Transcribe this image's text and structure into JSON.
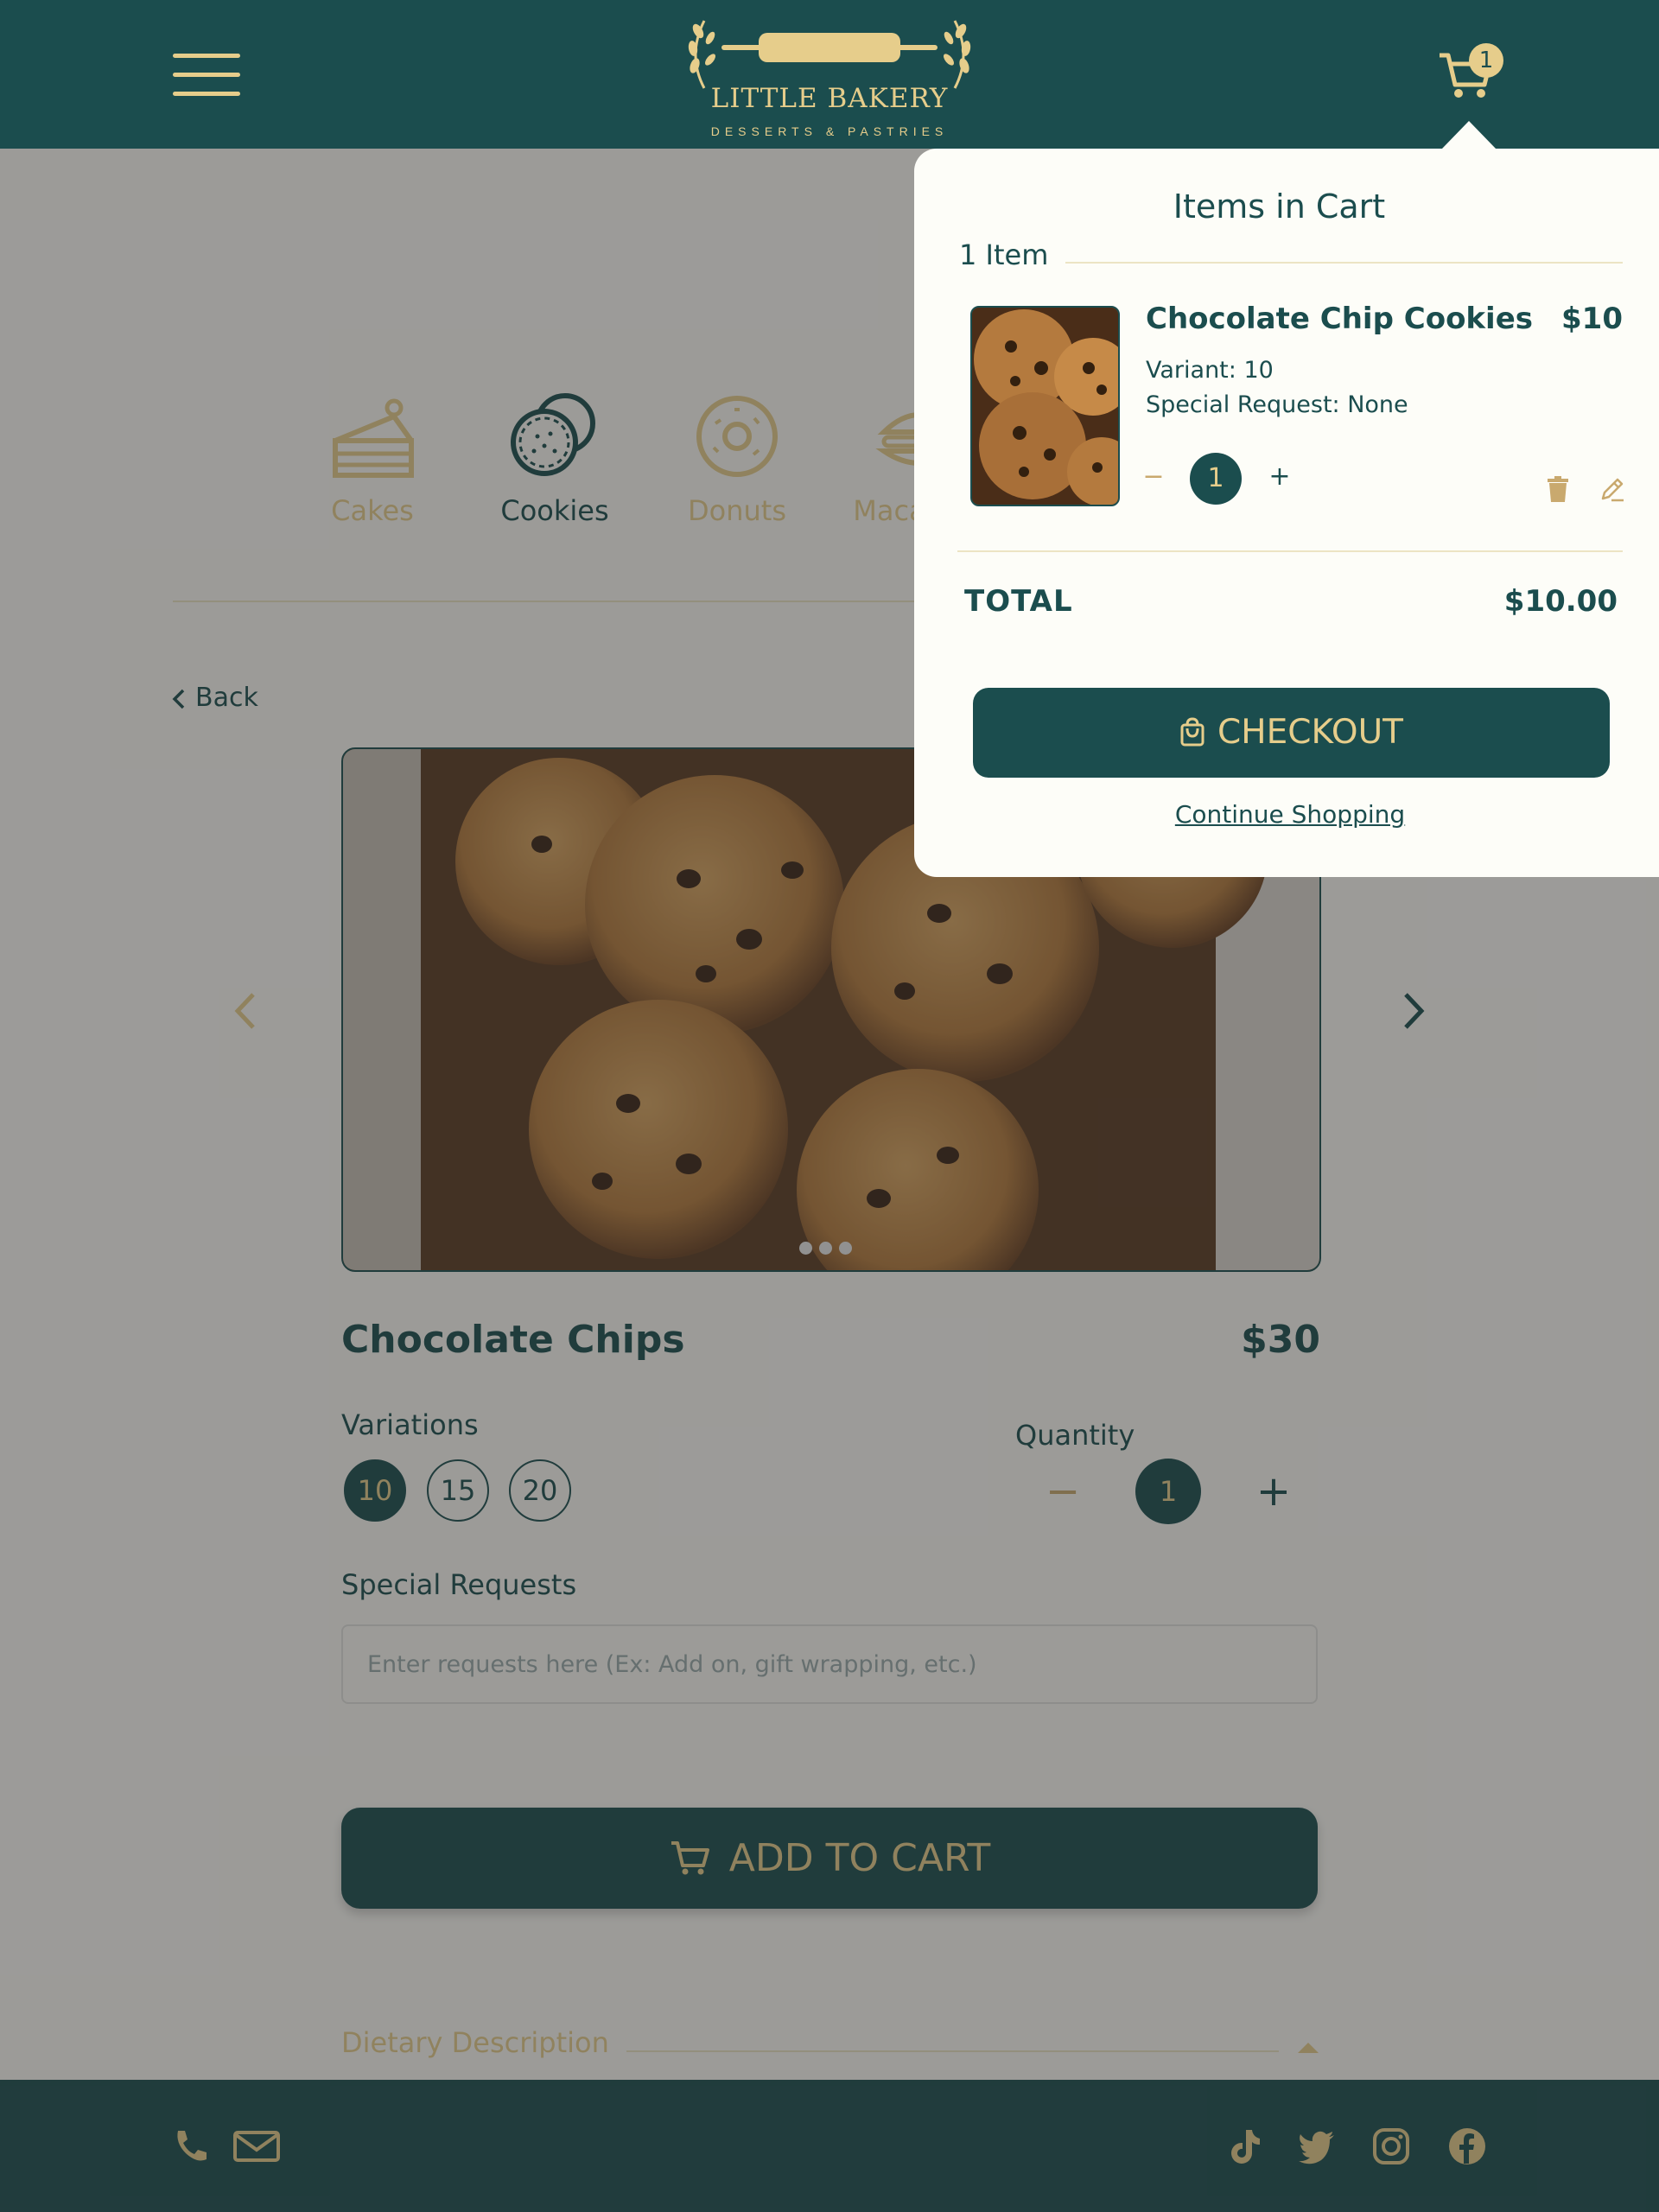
{
  "header": {
    "logo_title": "LITTLE BAKERY",
    "logo_subtitle": "DESSERTS & PASTRIES",
    "cart_count": "1"
  },
  "categories": [
    {
      "label": "Cakes",
      "icon": "cake-icon",
      "active": false
    },
    {
      "label": "Cookies",
      "icon": "cookie-icon",
      "active": true
    },
    {
      "label": "Donuts",
      "icon": "donut-icon",
      "active": false
    },
    {
      "label": "Macarons",
      "icon": "macaron-icon",
      "active": false
    }
  ],
  "product": {
    "back_label": "Back",
    "name": "Chocolate Chips",
    "price": "$30",
    "variations_label": "Variations",
    "variations": [
      "10",
      "15",
      "20"
    ],
    "selected_variation": "10",
    "quantity_label": "Quantity",
    "quantity_minus": "−",
    "quantity": "1",
    "quantity_plus": "+",
    "special_requests_label": "Special Requests",
    "special_requests_placeholder": "Enter requests here (Ex: Add on, gift wrapping, etc.)",
    "add_to_cart_label": "ADD TO CART",
    "dietary_label": "Dietary Description",
    "carousel_pages": 3,
    "carousel_active": 1
  },
  "cart": {
    "title": "Items in Cart",
    "count_label": "1 Item",
    "items": [
      {
        "name": "Chocolate Chip Cookies",
        "price": "$10",
        "variant": "Variant: 10",
        "special_request": "Special Request: None",
        "minus": "−",
        "quantity": "1",
        "plus": "+"
      }
    ],
    "total_label": "TOTAL",
    "total_value": "$10.00",
    "checkout_label": "CHECKOUT",
    "continue_label": "Continue Shopping"
  },
  "footer": {
    "contact_icons": [
      "phone-icon",
      "mail-icon"
    ],
    "social_icons": [
      "tiktok-icon",
      "twitter-icon",
      "instagram-icon",
      "facebook-icon"
    ]
  },
  "colors": {
    "primary": "#1b4d4e",
    "accent": "#e6cd8b",
    "background": "#fbfaf5"
  }
}
